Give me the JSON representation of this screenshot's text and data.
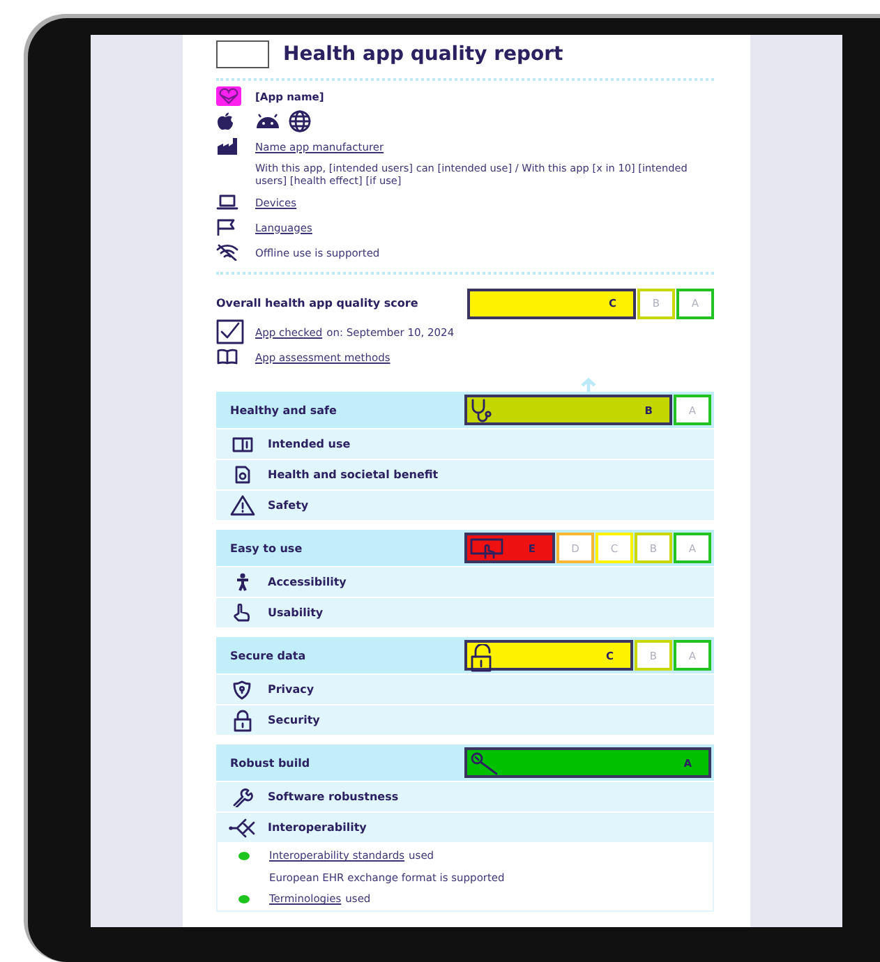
{
  "header": {
    "title": "Health app quality report"
  },
  "app": {
    "name": "[App name]"
  },
  "manufacturer": {
    "link": "Name app manufacturer"
  },
  "description": "With this app, [intended users] can [intended use] / With this app [x in 10] [intended users] [health effect] [if use]",
  "info_rows": [
    {
      "kind": "link",
      "text": "Devices"
    },
    {
      "kind": "link",
      "text": "Languages"
    },
    {
      "kind": "plain",
      "text": "Offline use is supported"
    }
  ],
  "overall": {
    "label": "Overall health app quality score",
    "grades": [
      {
        "label": "C",
        "color": "#fff200",
        "selected": true
      },
      {
        "label": "B",
        "color": "#c8d800",
        "selected": false
      },
      {
        "label": "A",
        "color": "#22c322",
        "selected": false
      }
    ]
  },
  "checked": {
    "link": "App checked",
    "text": "on: September 10, 2024"
  },
  "methods": {
    "link": "App assessment methods"
  },
  "sections": [
    {
      "title": "Healthy and safe",
      "grades": [
        {
          "label": "B",
          "color": "#c3d600",
          "selected": true
        },
        {
          "label": "A",
          "color": "#22c322",
          "selected": false
        }
      ],
      "items": [
        {
          "label": "Intended use"
        },
        {
          "label": "Health and societal benefit"
        },
        {
          "label": "Safety"
        }
      ]
    },
    {
      "title": "Easy to use",
      "grades": [
        {
          "label": "E",
          "color": "#ee1111",
          "selected": true
        },
        {
          "label": "D",
          "color": "#f7b733",
          "selected": false
        },
        {
          "label": "C",
          "color": "#fff200",
          "selected": false
        },
        {
          "label": "B",
          "color": "#c8d800",
          "selected": false
        },
        {
          "label": "A",
          "color": "#22c322",
          "selected": false
        }
      ],
      "items": [
        {
          "label": "Accessibility"
        },
        {
          "label": "Usability"
        }
      ]
    },
    {
      "title": "Secure data",
      "grades": [
        {
          "label": "C",
          "color": "#fff200",
          "selected": true
        },
        {
          "label": "B",
          "color": "#c8d800",
          "selected": false
        },
        {
          "label": "A",
          "color": "#22c322",
          "selected": false
        }
      ],
      "items": [
        {
          "label": "Privacy"
        },
        {
          "label": "Security"
        }
      ]
    },
    {
      "title": "Robust build",
      "grades": [
        {
          "label": "A",
          "color": "#00c000",
          "selected": true
        }
      ],
      "items": [
        {
          "label": "Software robustness"
        },
        {
          "label": "Interoperability"
        }
      ],
      "details": [
        {
          "color": "#1ec41e",
          "link": "Interoperability standards",
          "text": "used"
        },
        {
          "text": "European EHR exchange format is supported"
        },
        {
          "color": "#1ec41e",
          "link": "Terminologies",
          "text": "used"
        }
      ]
    }
  ]
}
